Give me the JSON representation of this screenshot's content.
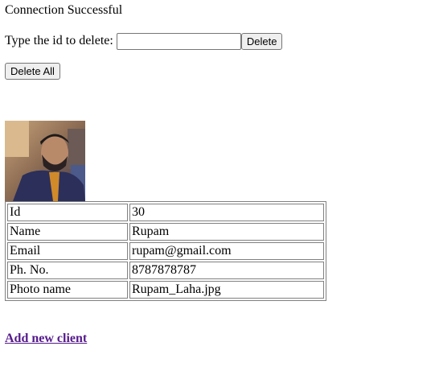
{
  "status_message": "Connection Successful",
  "delete_form": {
    "label": "Type the id to delete:",
    "input_value": "",
    "delete_button": "Delete"
  },
  "delete_all_button": "Delete All",
  "client": {
    "rows": [
      {
        "key": "Id",
        "value": "30"
      },
      {
        "key": "Name",
        "value": "Rupam"
      },
      {
        "key": "Email",
        "value": "rupam@gmail.com"
      },
      {
        "key": "Ph. No.",
        "value": "8787878787"
      },
      {
        "key": "Photo name",
        "value": "Rupam_Laha.jpg"
      }
    ]
  },
  "add_client_link": "Add new client"
}
